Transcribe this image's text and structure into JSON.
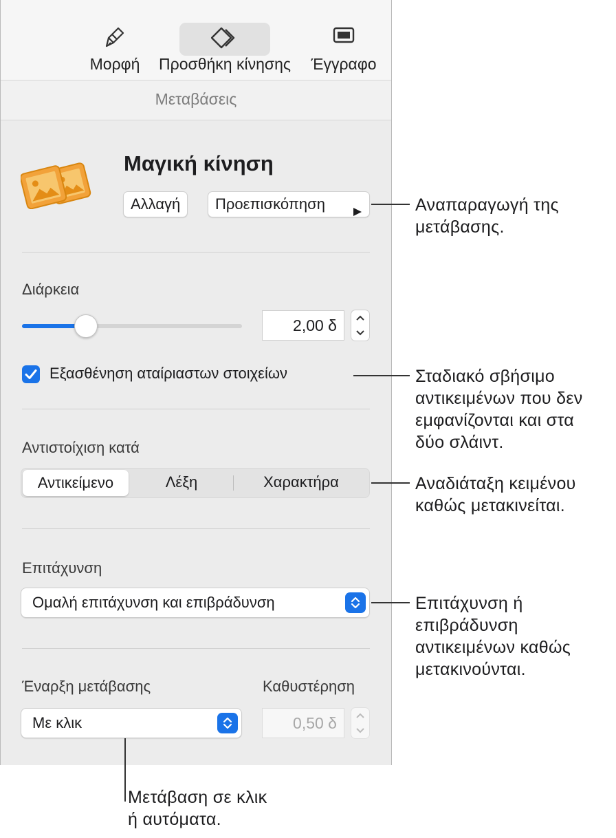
{
  "toolbar": {
    "format_label": "Μορφή",
    "animate_label": "Προσθήκη κίνησης",
    "document_label": "Έγγραφο"
  },
  "tab": {
    "label": "Μεταβάσεις"
  },
  "transition": {
    "title": "Μαγική κίνηση",
    "change_label": "Αλλαγή",
    "preview_label": "Προεπισκόπηση"
  },
  "duration": {
    "label": "Διάρκεια",
    "value": "2,00 δ",
    "slider_fraction": 0.29
  },
  "fade": {
    "label": "Εξασθένηση αταίριαστων στοιχείων",
    "checked": true
  },
  "match": {
    "label": "Αντιστοίχιση κατά",
    "options": [
      "Αντικείμενο",
      "Λέξη",
      "Χαρακτήρα"
    ],
    "selected": "Αντικείμενο"
  },
  "acceleration": {
    "label": "Επιτάχυνση",
    "value": "Ομαλή επιτάχυνση και επιβράδυνση"
  },
  "start": {
    "label": "Έναρξη μετάβασης",
    "value": "Με κλικ"
  },
  "delay": {
    "label": "Καθυστέρηση",
    "value": "0,50 δ"
  },
  "callouts": {
    "preview": [
      "Αναπαραγωγή της",
      "μετάβασης."
    ],
    "fade": [
      "Σταδιακό σβήσιμο",
      "αντικειμένων που δεν",
      "εμφανίζονται και στα",
      "δύο σλάιντ."
    ],
    "match": [
      "Αναδιάταξη κειμένου",
      "καθώς μετακινείται."
    ],
    "acceleration": [
      "Επιτάχυνση ή",
      "επιβράδυνση",
      "αντικειμένων καθώς",
      "μετακινούνται."
    ],
    "start": [
      "Μετάβαση σε κλικ",
      "ή αυτόματα."
    ]
  },
  "colors": {
    "accent": "#1a73e8",
    "icon_orange": "#f2a23a"
  }
}
